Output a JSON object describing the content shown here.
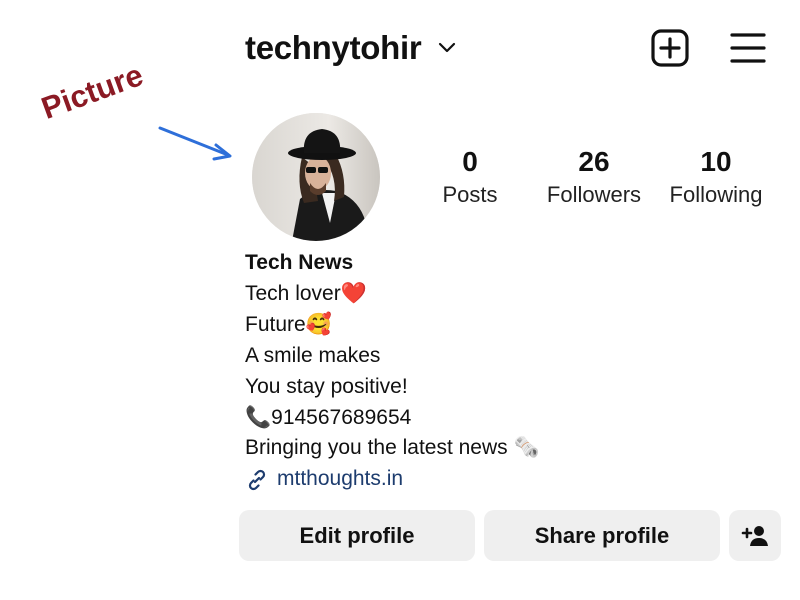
{
  "header": {
    "username": "technytohir",
    "icons": {
      "chevron": "chevron-down-icon",
      "add": "plus-square-icon",
      "menu": "hamburger-menu-icon"
    }
  },
  "annotation": {
    "label": "Picture",
    "color": "#8b1a24",
    "arrow_color": "#2e6fd9"
  },
  "profile": {
    "stats": [
      {
        "value": "0",
        "label": "Posts"
      },
      {
        "value": "26",
        "label": "Followers"
      },
      {
        "value": "10",
        "label": "Following"
      }
    ],
    "bio": {
      "name": "Tech News",
      "lines": [
        "Tech lover❤️",
        "Future🥰",
        "A smile makes",
        "You stay positive!",
        "📞914567689654",
        "Bringing you the latest news 🗞️"
      ],
      "link": "mtthoughts.in",
      "link_color": "#1d3c6e"
    }
  },
  "actions": {
    "edit_profile": "Edit profile",
    "share_profile": "Share profile",
    "add_user_icon": "add-person-icon",
    "button_bg": "#efefef"
  }
}
